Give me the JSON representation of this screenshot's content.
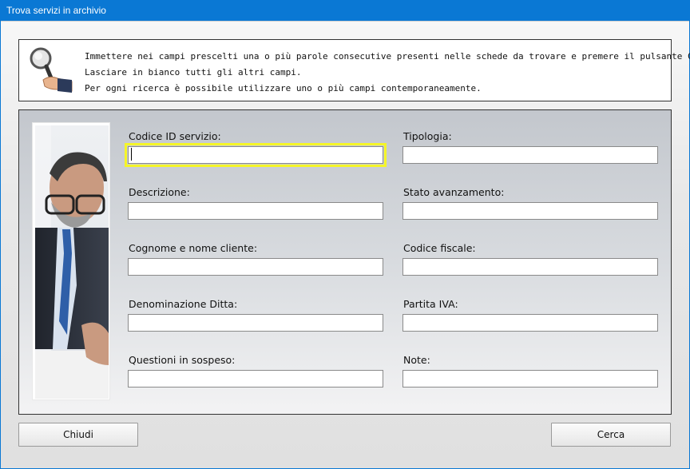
{
  "window": {
    "title": "Trova servizi in archivio"
  },
  "info": {
    "line1": "Immettere nei campi prescelti una o più parole consecutive presenti nelle schede da trovare e premere il pulsante Cerca.",
    "line2": "Lasciare in bianco tutti gli altri campi.",
    "line3": "Per ogni ricerca è possibile utilizzare uno o più campi contemporaneamente."
  },
  "fields": {
    "codice_id": {
      "label": "Codice ID servizio:",
      "value": ""
    },
    "tipologia": {
      "label": "Tipologia:",
      "value": ""
    },
    "descrizione": {
      "label": "Descrizione:",
      "value": ""
    },
    "stato": {
      "label": "Stato avanzamento:",
      "value": ""
    },
    "cliente": {
      "label": "Cognome e nome cliente:",
      "value": ""
    },
    "codice_fiscale": {
      "label": "Codice fiscale:",
      "value": ""
    },
    "ditta": {
      "label": "Denominazione Ditta:",
      "value": ""
    },
    "partita_iva": {
      "label": "Partita IVA:",
      "value": ""
    },
    "questioni": {
      "label": "Questioni in sospeso:",
      "value": ""
    },
    "note": {
      "label": "Note:",
      "value": ""
    }
  },
  "buttons": {
    "close": "Chiudi",
    "search": "Cerca"
  },
  "colors": {
    "titlebar": "#0a78d4",
    "focus": "#f5f528"
  },
  "icons": {
    "info": "magnifier-hand-icon"
  }
}
